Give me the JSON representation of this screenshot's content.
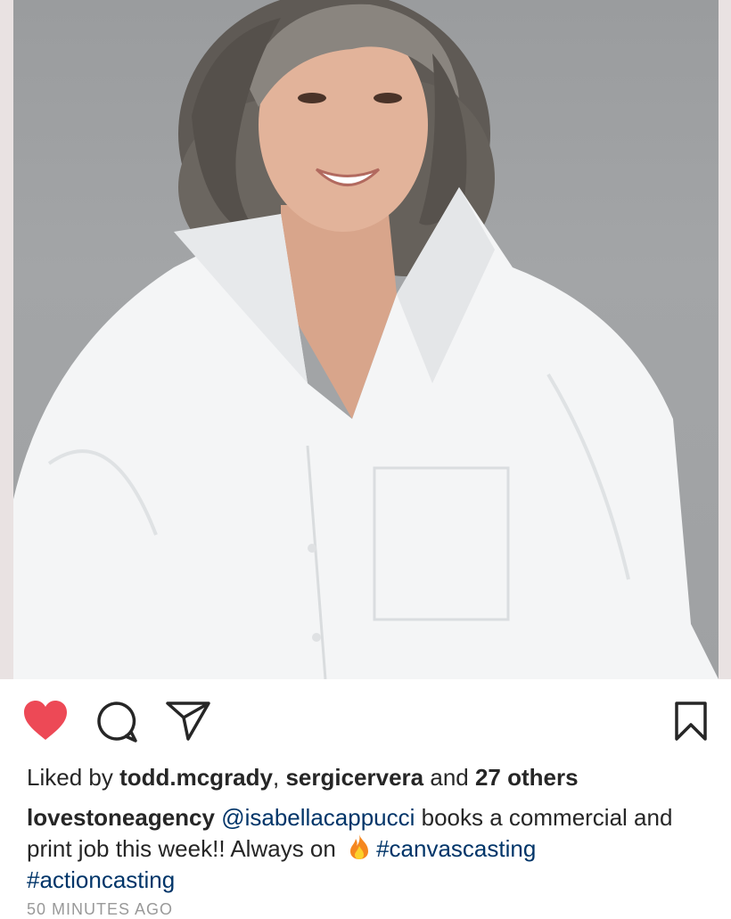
{
  "post": {
    "photo_alt": "",
    "actions": {
      "like_icon": "heart-filled-icon",
      "comment_icon": "comment-icon",
      "share_icon": "paper-plane-icon",
      "save_icon": "bookmark-icon",
      "like_color": "#ed4956"
    },
    "likes": {
      "prefix": "Liked by ",
      "user1": "todd.mcgrady",
      "sep": ", ",
      "user2": "sergicervera",
      "and": " and ",
      "others": "27 others"
    },
    "caption": {
      "username": "lovestoneagency",
      "mention": "@isabellacappucci",
      "text": " books a commercial and print job this week!! Always on ",
      "emoji": "fire-emoji",
      "hashtag1": "#canvascasting",
      "hashtag2": "#actioncasting"
    },
    "timestamp": "50 MINUTES AGO"
  }
}
